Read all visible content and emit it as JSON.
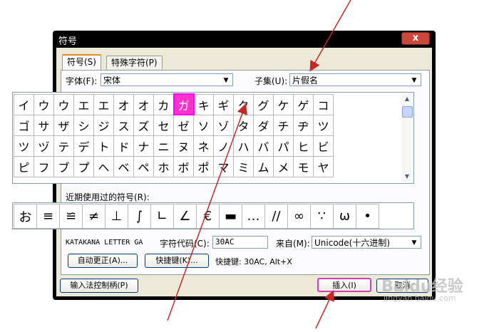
{
  "window": {
    "title": "符号",
    "close": "x"
  },
  "tabs": [
    {
      "label": "符号(S)"
    },
    {
      "label": "特殊字符(P)"
    }
  ],
  "font": {
    "label": "字体(F):",
    "value": "宋体"
  },
  "subset": {
    "label": "子集(U):",
    "value": "片假名"
  },
  "grid": {
    "rows": [
      [
        "イ",
        "ウ",
        "ウ",
        "エ",
        "エ",
        "オ",
        "オ",
        "カ",
        "ガ",
        "キ",
        "ギ",
        "ク",
        "グ",
        "ケ",
        "ゲ",
        "コ"
      ],
      [
        "ゴ",
        "サ",
        "ザ",
        "シ",
        "ジ",
        "ス",
        "ズ",
        "セ",
        "ゼ",
        "ソ",
        "ゾ",
        "タ",
        "ダ",
        "チ",
        "ヂ",
        "ツ"
      ],
      [
        "ツ",
        "ヅ",
        "テ",
        "デ",
        "ト",
        "ド",
        "ナ",
        "ニ",
        "ヌ",
        "ネ",
        "ノ",
        "ハ",
        "バ",
        "パ",
        "ヒ",
        "ビ"
      ],
      [
        "ピ",
        "フ",
        "ブ",
        "プ",
        "ヘ",
        "ベ",
        "ペ",
        "ホ",
        "ボ",
        "ポ",
        "マ",
        "ミ",
        "ム",
        "メ",
        "モ",
        "ヤ"
      ]
    ],
    "selected": "ガ"
  },
  "recent": {
    "label": "近期使用过的符号(R):",
    "symbols": [
      "お",
      "≡",
      "≌",
      "≠",
      "⊥",
      "∫",
      "∟",
      "∠",
      "€",
      "▬",
      "…",
      "//",
      "∞",
      "∵",
      "ω",
      "•"
    ]
  },
  "char_name": "KATAKANA LETTER GA",
  "char_code": {
    "label": "字符代码(C):",
    "value": "30AC"
  },
  "from": {
    "label": "来自(M):",
    "value": "Unicode(十六进制)"
  },
  "buttons": {
    "autocorrect": "自动更正(A)...",
    "shortcut_key": "快捷键(K)...",
    "ime_pad": "输入法控制柄(P)",
    "insert": "插入(I)",
    "cancel": "取消"
  },
  "shortcut_text": "快捷键: 30AC, Alt+X",
  "watermark": {
    "main": "Baidu经验",
    "sub": "jingyan.baidu.com"
  }
}
